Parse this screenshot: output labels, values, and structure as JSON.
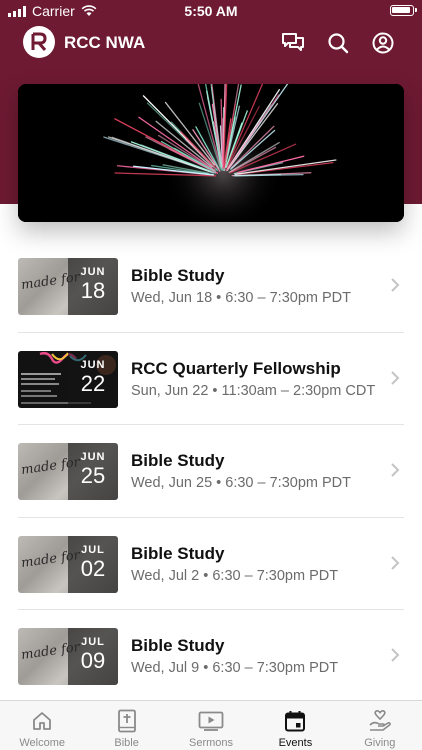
{
  "status_bar": {
    "carrier": "Carrier",
    "time": "5:50 AM"
  },
  "header": {
    "title": "RCC NWA",
    "logo_letter": "R"
  },
  "colors": {
    "brand": "#6d1a32",
    "tab_active": "#111111",
    "tab_inactive": "#8a8a8a"
  },
  "events": [
    {
      "title": "Bible Study",
      "time": "Wed, Jun 18 • 6:30 – 7:30pm PDT",
      "month": "JUN",
      "day": "18",
      "thumb": "made-for-more"
    },
    {
      "title": "RCC Quarterly Fellowship",
      "time": "Sun, Jun 22 • 11:30am – 2:30pm CDT",
      "month": "JUN",
      "day": "22",
      "thumb": "fellowship-flyer"
    },
    {
      "title": "Bible Study",
      "time": "Wed, Jun 25 • 6:30 – 7:30pm PDT",
      "month": "JUN",
      "day": "25",
      "thumb": "made-for-more"
    },
    {
      "title": "Bible Study",
      "time": "Wed, Jul 2 • 6:30 – 7:30pm PDT",
      "month": "JUL",
      "day": "02",
      "thumb": "made-for-more"
    },
    {
      "title": "Bible Study",
      "time": "Wed, Jul 9 • 6:30 – 7:30pm PDT",
      "month": "JUL",
      "day": "09",
      "thumb": "made-for-more"
    }
  ],
  "tabs": [
    {
      "label": "Welcome",
      "icon": "home-icon"
    },
    {
      "label": "Bible",
      "icon": "bible-icon"
    },
    {
      "label": "Sermons",
      "icon": "video-icon"
    },
    {
      "label": "Events",
      "icon": "calendar-icon",
      "active": true
    },
    {
      "label": "Giving",
      "icon": "giving-icon"
    }
  ]
}
